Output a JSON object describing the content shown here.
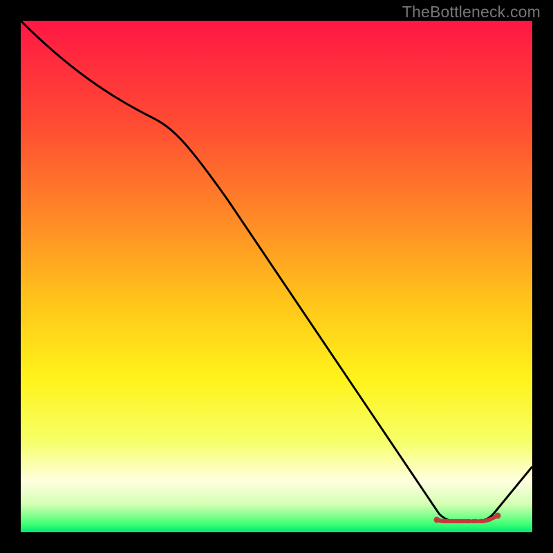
{
  "watermark": "TheBottleneck.com",
  "chart_data": {
    "type": "line",
    "title": "",
    "xlabel": "",
    "ylabel": "",
    "xlim": [
      0,
      100
    ],
    "ylim": [
      0,
      100
    ],
    "x": [
      0,
      25,
      82,
      89,
      100
    ],
    "y": [
      100,
      82,
      0,
      0,
      13
    ],
    "series_color": "#000000",
    "flat_zone_x": [
      82,
      89
    ],
    "flat_zone_y": 0,
    "gradient_stops": [
      {
        "offset": 0.0,
        "color": "#ff1744"
      },
      {
        "offset": 0.2,
        "color": "#ff4b33"
      },
      {
        "offset": 0.4,
        "color": "#ff8e26"
      },
      {
        "offset": 0.55,
        "color": "#ffc51a"
      },
      {
        "offset": 0.7,
        "color": "#fff31a"
      },
      {
        "offset": 0.82,
        "color": "#f6ff66"
      },
      {
        "offset": 0.9,
        "color": "#ffffe0"
      },
      {
        "offset": 0.945,
        "color": "#d4ffb3"
      },
      {
        "offset": 0.97,
        "color": "#7aff8a"
      },
      {
        "offset": 0.985,
        "color": "#3aff72"
      },
      {
        "offset": 1.0,
        "color": "#00e676"
      }
    ],
    "dash_markers": {
      "color": "#cc3333",
      "count": 12
    }
  }
}
